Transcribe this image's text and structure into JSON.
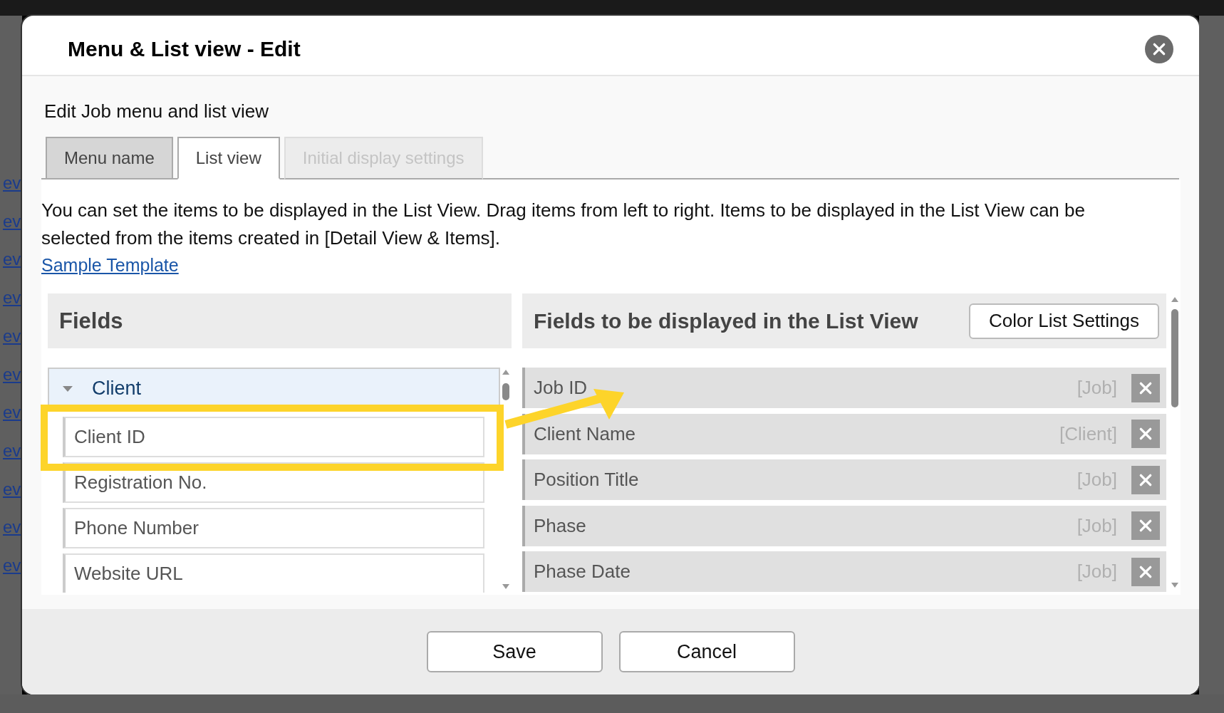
{
  "background_links": [
    "ev",
    "ev",
    "ev",
    "ev",
    "ev",
    "ev",
    "ev",
    "ev",
    "ev",
    "ev",
    "ev"
  ],
  "window": {
    "title": "Menu & List view - Edit"
  },
  "subtitle": "Edit Job menu and list view",
  "tabs": [
    {
      "label": "Menu name",
      "selected": false,
      "disabled": false
    },
    {
      "label": "List view",
      "selected": true,
      "disabled": false
    },
    {
      "label": "Initial display settings",
      "selected": false,
      "disabled": true
    }
  ],
  "description": "You can set the items to be displayed in the List View. Drag items from left to right. Items to be displayed in the List View can be selected from the items created in [Detail View & Items].",
  "link": "Sample Template",
  "fields_panel": {
    "title": "Fields",
    "groups": [
      {
        "label": "Client",
        "expanded": true,
        "items": [
          "Client ID",
          "Registration No.",
          "Phone Number",
          "Website URL"
        ]
      }
    ]
  },
  "display_panel": {
    "title": "Fields to be displayed in the List View",
    "button": "Color List Settings",
    "rows": [
      {
        "name": "Job ID",
        "source": "[Job]"
      },
      {
        "name": "Client Name",
        "source": "[Client]"
      },
      {
        "name": "Position Title",
        "source": "[Job]"
      },
      {
        "name": "Phase",
        "source": "[Job]"
      },
      {
        "name": "Phase Date",
        "source": "[Job]"
      }
    ]
  },
  "buttons": [
    "Save",
    "Cancel"
  ]
}
